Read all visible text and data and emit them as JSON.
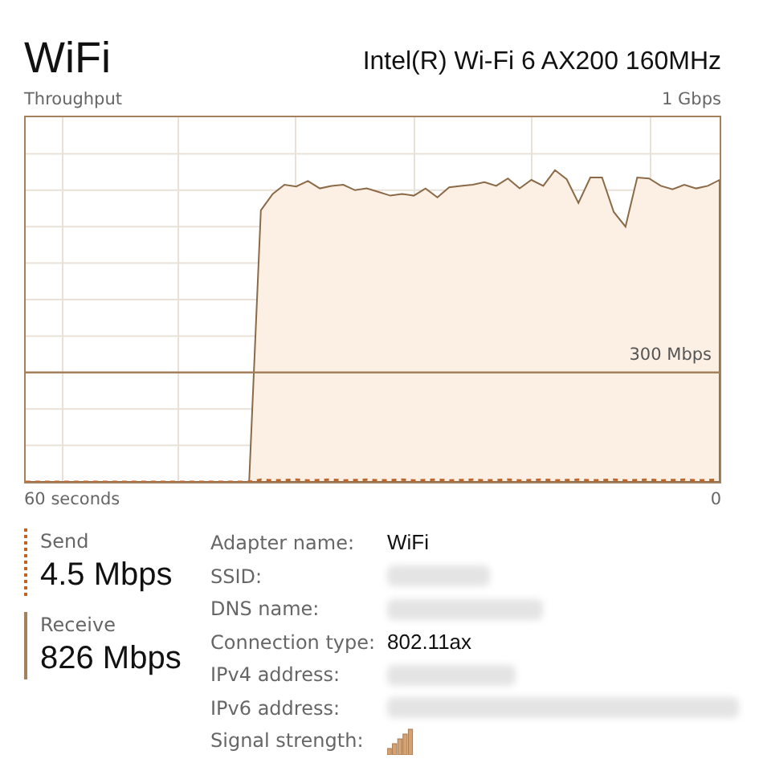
{
  "header": {
    "title": "WiFi",
    "adapter": "Intel(R) Wi-Fi 6 AX200 160MHz"
  },
  "throughput": {
    "title": "Throughput",
    "scale_max": "1 Gbps",
    "reference_label": "300 Mbps",
    "time_start": "60 seconds",
    "time_end": "0"
  },
  "stats": [
    {
      "kind": "dotted",
      "label": "Send",
      "value": "4.5 Mbps"
    },
    {
      "kind": "solid",
      "label": "Receive",
      "value": "826 Mbps"
    }
  ],
  "details": [
    {
      "label": "Adapter name:",
      "kind": "text",
      "value": "WiFi"
    },
    {
      "label": "SSID:",
      "kind": "redacted"
    },
    {
      "label": "DNS name:",
      "kind": "redacted"
    },
    {
      "label": "Connection type:",
      "kind": "text",
      "value": "802.11ax"
    },
    {
      "label": "IPv4 address:",
      "kind": "redacted"
    },
    {
      "label": "IPv6 address:",
      "kind": "redacted"
    },
    {
      "label": "Signal strength:",
      "kind": "signal"
    }
  ]
}
